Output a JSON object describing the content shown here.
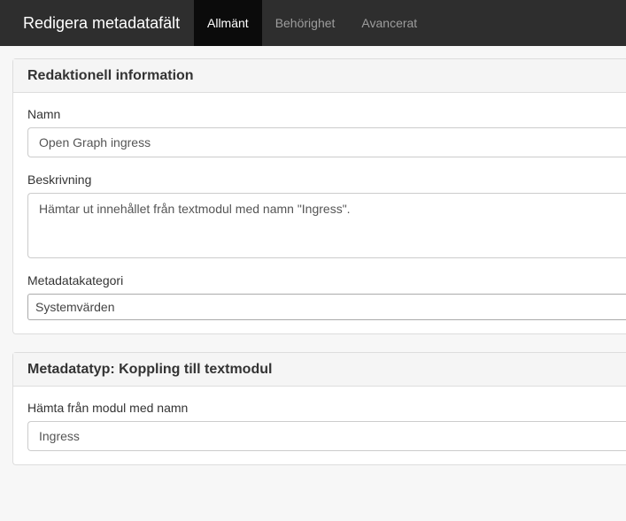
{
  "navbar": {
    "brand": "Redigera metadatafält",
    "tabs": [
      {
        "label": "Allmänt",
        "active": true
      },
      {
        "label": "Behörighet",
        "active": false
      },
      {
        "label": "Avancerat",
        "active": false
      }
    ]
  },
  "panels": {
    "editorial": {
      "heading": "Redaktionell information",
      "name_label": "Namn",
      "name_value": "Open Graph ingress",
      "description_label": "Beskrivning",
      "description_value": "Hämtar ut innehållet från textmodul med namn \"Ingress\".",
      "category_label": "Metadatakategori",
      "category_value": "Systemvärden"
    },
    "metadatatype": {
      "heading": "Metadatatyp: Koppling till textmodul",
      "module_label": "Hämta från modul med namn",
      "module_value": "Ingress"
    }
  }
}
